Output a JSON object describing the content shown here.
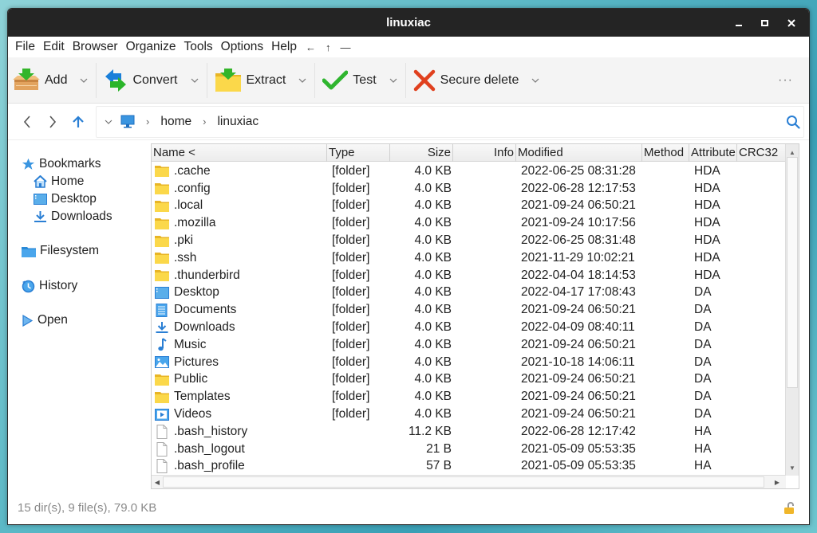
{
  "window": {
    "title": "linuxiac",
    "controls": {
      "minimize": "minimize-icon",
      "maximize": "maximize-icon",
      "close": "close-icon"
    }
  },
  "menu": {
    "items": [
      "File",
      "Edit",
      "Browser",
      "Organize",
      "Tools",
      "Options",
      "Help"
    ],
    "arrows": [
      "←",
      "↑",
      "—"
    ]
  },
  "toolbar": {
    "buttons": [
      {
        "label": "Add",
        "icon": "add-archive-icon"
      },
      {
        "label": "Convert",
        "icon": "convert-icon"
      },
      {
        "label": "Extract",
        "icon": "extract-icon"
      },
      {
        "label": "Test",
        "icon": "checkmark-icon"
      },
      {
        "label": "Secure delete",
        "icon": "delete-x-icon"
      }
    ],
    "dropdown_glyph": "⌄",
    "more_glyph": "···"
  },
  "address": {
    "root_icon": "computer-icon",
    "crumbs": [
      "home",
      "linuxiac"
    ],
    "separator": "›"
  },
  "sidebar": {
    "bookmarks_label": "Bookmarks",
    "bookmarks": [
      {
        "label": "Home",
        "icon": "home-icon"
      },
      {
        "label": "Desktop",
        "icon": "desktop-icon"
      },
      {
        "label": "Downloads",
        "icon": "download-icon"
      }
    ],
    "filesystem_label": "Filesystem",
    "history_label": "History",
    "open_label": "Open"
  },
  "table": {
    "columns": [
      "Name <",
      "Type",
      "Size",
      "Info",
      "Modified",
      "Method",
      "Attribute",
      "CRC32"
    ],
    "rows": [
      {
        "name": ".cache",
        "icon": "folder",
        "type": "[folder]",
        "size": "4.0 KB",
        "info": "",
        "modified": "2022-06-25 08:31:28",
        "method": "",
        "attr": "HDA",
        "crc": ""
      },
      {
        "name": ".config",
        "icon": "folder",
        "type": "[folder]",
        "size": "4.0 KB",
        "info": "",
        "modified": "2022-06-28 12:17:53",
        "method": "",
        "attr": "HDA",
        "crc": ""
      },
      {
        "name": ".local",
        "icon": "folder",
        "type": "[folder]",
        "size": "4.0 KB",
        "info": "",
        "modified": "2021-09-24 06:50:21",
        "method": "",
        "attr": "HDA",
        "crc": ""
      },
      {
        "name": ".mozilla",
        "icon": "folder",
        "type": "[folder]",
        "size": "4.0 KB",
        "info": "",
        "modified": "2021-09-24 10:17:56",
        "method": "",
        "attr": "HDA",
        "crc": ""
      },
      {
        "name": ".pki",
        "icon": "folder",
        "type": "[folder]",
        "size": "4.0 KB",
        "info": "",
        "modified": "2022-06-25 08:31:48",
        "method": "",
        "attr": "HDA",
        "crc": ""
      },
      {
        "name": ".ssh",
        "icon": "folder",
        "type": "[folder]",
        "size": "4.0 KB",
        "info": "",
        "modified": "2021-11-29 10:02:21",
        "method": "",
        "attr": "HDA",
        "crc": ""
      },
      {
        "name": ".thunderbird",
        "icon": "folder",
        "type": "[folder]",
        "size": "4.0 KB",
        "info": "",
        "modified": "2022-04-04 18:14:53",
        "method": "",
        "attr": "HDA",
        "crc": ""
      },
      {
        "name": "Desktop",
        "icon": "desktop",
        "type": "[folder]",
        "size": "4.0 KB",
        "info": "",
        "modified": "2022-04-17 17:08:43",
        "method": "",
        "attr": "DA",
        "crc": ""
      },
      {
        "name": "Documents",
        "icon": "documents",
        "type": "[folder]",
        "size": "4.0 KB",
        "info": "",
        "modified": "2021-09-24 06:50:21",
        "method": "",
        "attr": "DA",
        "crc": ""
      },
      {
        "name": "Downloads",
        "icon": "download",
        "type": "[folder]",
        "size": "4.0 KB",
        "info": "",
        "modified": "2022-04-09 08:40:11",
        "method": "",
        "attr": "DA",
        "crc": ""
      },
      {
        "name": "Music",
        "icon": "music",
        "type": "[folder]",
        "size": "4.0 KB",
        "info": "",
        "modified": "2021-09-24 06:50:21",
        "method": "",
        "attr": "DA",
        "crc": ""
      },
      {
        "name": "Pictures",
        "icon": "pictures",
        "type": "[folder]",
        "size": "4.0 KB",
        "info": "",
        "modified": "2021-10-18 14:06:11",
        "method": "",
        "attr": "DA",
        "crc": ""
      },
      {
        "name": "Public",
        "icon": "folder",
        "type": "[folder]",
        "size": "4.0 KB",
        "info": "",
        "modified": "2021-09-24 06:50:21",
        "method": "",
        "attr": "DA",
        "crc": ""
      },
      {
        "name": "Templates",
        "icon": "folder",
        "type": "[folder]",
        "size": "4.0 KB",
        "info": "",
        "modified": "2021-09-24 06:50:21",
        "method": "",
        "attr": "DA",
        "crc": ""
      },
      {
        "name": "Videos",
        "icon": "videos",
        "type": "[folder]",
        "size": "4.0 KB",
        "info": "",
        "modified": "2021-09-24 06:50:21",
        "method": "",
        "attr": "DA",
        "crc": ""
      },
      {
        "name": ".bash_history",
        "icon": "file",
        "type": "",
        "size": "11.2 KB",
        "info": "",
        "modified": "2022-06-28 12:17:42",
        "method": "",
        "attr": "HA",
        "crc": ""
      },
      {
        "name": ".bash_logout",
        "icon": "file",
        "type": "",
        "size": "21 B",
        "info": "",
        "modified": "2021-05-09 05:53:35",
        "method": "",
        "attr": "HA",
        "crc": ""
      },
      {
        "name": ".bash_profile",
        "icon": "file",
        "type": "",
        "size": "57 B",
        "info": "",
        "modified": "2021-05-09 05:53:35",
        "method": "",
        "attr": "HA",
        "crc": ""
      }
    ]
  },
  "status": {
    "summary": "15 dir(s), 9 file(s), 79.0 KB",
    "lock_icon": "unlocked-icon"
  },
  "colors": {
    "titlebar": "#242424",
    "accent_blue": "#2a7fd4",
    "folder_yellow": "#f8cf3c",
    "check_green": "#2fb52f",
    "delete_red": "#e0401e",
    "lock_orange": "#f0b62a"
  }
}
